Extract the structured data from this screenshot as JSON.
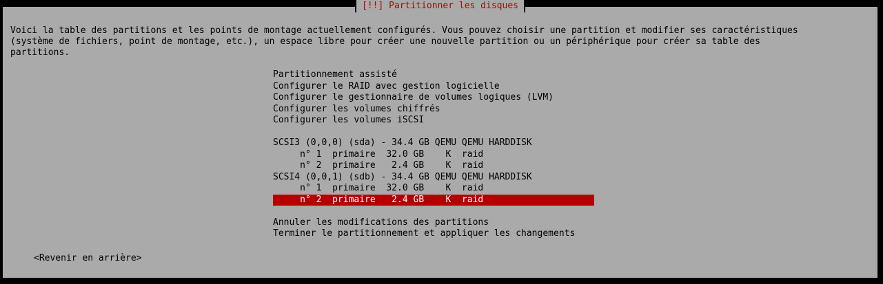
{
  "dialog": {
    "title": "[!!] Partitionner les disques",
    "description": [
      "Voici la table des partitions et les points de montage actuellement configurés. Vous pouvez choisir une partition et modifier ses caractéristiques",
      "(système de fichiers, point de montage, etc.), un espace libre pour créer une nouvelle partition ou un périphérique pour créer sa table des",
      "partitions."
    ]
  },
  "menu": {
    "actions": [
      "Partitionnement assisté",
      "Configurer le RAID avec gestion logicielle",
      "Configurer le gestionnaire de volumes logiques (LVM)",
      "Configurer les volumes chiffrés",
      "Configurer les volumes iSCSI"
    ],
    "disks": [
      {
        "label": "SCSI3 (0,0,0) (sda) - 34.4 GB QEMU QEMU HARDDISK",
        "partitions": [
          "     n° 1  primaire  32.0 GB    K  raid",
          "     n° 2  primaire   2.4 GB    K  raid"
        ]
      },
      {
        "label": "SCSI4 (0,0,1) (sdb) - 34.4 GB QEMU QEMU HARDDISK",
        "partitions": [
          "     n° 1  primaire  32.0 GB    K  raid",
          "     n° 2  primaire   2.4 GB    K  raid"
        ]
      }
    ],
    "finish": [
      "Annuler les modifications des partitions",
      "Terminer le partitionnement et appliquer les changements"
    ]
  },
  "back_button": "<Revenir en arrière>",
  "colors": {
    "background": "#aaaaaa",
    "title": "#b30000",
    "selection": "#b30000"
  }
}
